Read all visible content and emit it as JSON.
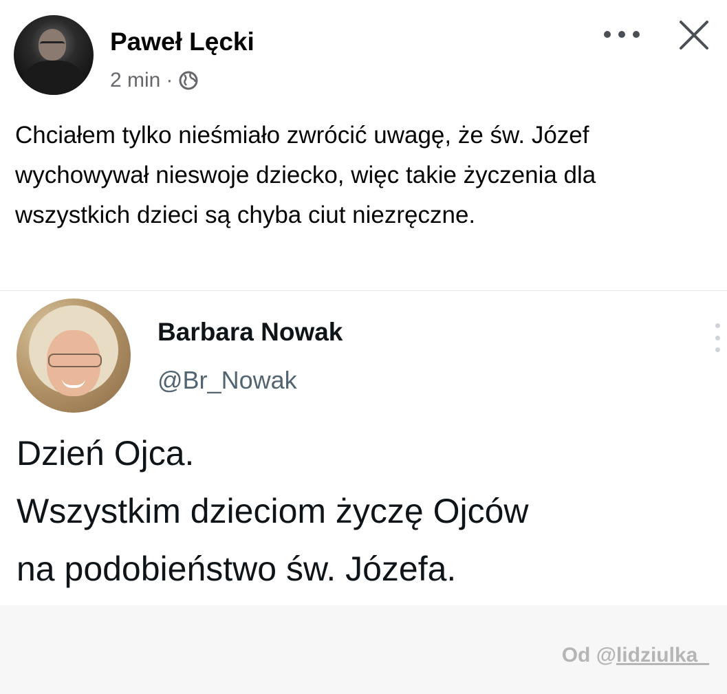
{
  "post": {
    "author": "Paweł Lęcki",
    "time": "2 min",
    "separator": "·",
    "privacy_icon": "globe-icon",
    "text": "Chciałem tylko nieśmiało zwrócić uwagę, że św. Józef wychowywał nieswoje dziecko, więc takie życzenia dla wszystkich dzieci są chyba ciut niezręczne."
  },
  "header_actions": {
    "more_icon": "more-horizontal-icon",
    "close_icon": "close-icon"
  },
  "tweet": {
    "name": "Barbara Nowak",
    "handle": "@Br_Nowak",
    "lines": [
      "Dzień Ojca.",
      "Wszystkim dzieciom życzę Ojców",
      "na podobieństwo św. Józefa."
    ]
  },
  "credit": {
    "prefix": "Od @",
    "user": "lidziulka_"
  },
  "colors": {
    "text": "#050505",
    "meta": "#65676b",
    "handle": "#536471",
    "credit": "#b5b5b5"
  }
}
